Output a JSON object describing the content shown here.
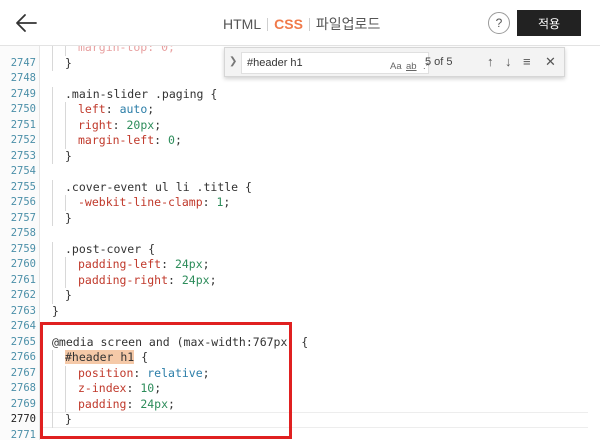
{
  "tabs": [
    {
      "label": "HTML",
      "active": false
    },
    {
      "label": "CSS",
      "active": true
    },
    {
      "label": "파일업로드",
      "active": false
    }
  ],
  "help_label": "?",
  "apply_label": "적용",
  "find": {
    "query": "#header h1",
    "match_case": "Aa",
    "whole_word": "ab",
    "regex": ".*",
    "count": "5 of 5"
  },
  "code_lines": [
    {
      "n": "2747",
      "html": "<span class=\"ind\"></span><span class=\"kw\">}</span>"
    },
    {
      "n": "2748",
      "html": ""
    },
    {
      "n": "2749",
      "html": "<span class=\"ind\"></span><span class=\"sel\">.main-slider .paging {</span>"
    },
    {
      "n": "2750",
      "html": "<span class=\"ind\"></span><span class=\"ind\"></span><span class=\"prop\">left</span>: <span class=\"val\">auto</span>;"
    },
    {
      "n": "2751",
      "html": "<span class=\"ind\"></span><span class=\"ind\"></span><span class=\"prop\">right</span>: <span class=\"num\">20px</span>;"
    },
    {
      "n": "2752",
      "html": "<span class=\"ind\"></span><span class=\"ind\"></span><span class=\"prop\">margin-left</span>: <span class=\"num\">0</span>;"
    },
    {
      "n": "2753",
      "html": "<span class=\"ind\"></span>}"
    },
    {
      "n": "2754",
      "html": ""
    },
    {
      "n": "2755",
      "html": "<span class=\"ind\"></span><span class=\"sel\">.cover-event ul li .title {</span>"
    },
    {
      "n": "2756",
      "html": "<span class=\"ind\"></span><span class=\"ind\"></span><span class=\"prop\">-webkit-line-clamp</span>: <span class=\"num\">1</span>;"
    },
    {
      "n": "2757",
      "html": "<span class=\"ind\"></span>}"
    },
    {
      "n": "2758",
      "html": ""
    },
    {
      "n": "2759",
      "html": "<span class=\"ind\"></span><span class=\"sel\">.post-cover {</span>"
    },
    {
      "n": "2760",
      "html": "<span class=\"ind\"></span><span class=\"ind\"></span><span class=\"prop\">padding-left</span>: <span class=\"num\">24px</span>;"
    },
    {
      "n": "2761",
      "html": "<span class=\"ind\"></span><span class=\"ind\"></span><span class=\"prop\">padding-right</span>: <span class=\"num\">24px</span>;"
    },
    {
      "n": "2762",
      "html": "<span class=\"ind\"></span>}"
    },
    {
      "n": "2763",
      "html": "}"
    },
    {
      "n": "2764",
      "html": ""
    },
    {
      "n": "2765",
      "html": "<span class=\"sel\">@media screen and (max-width:767px) {</span>"
    },
    {
      "n": "2766",
      "html": "<span class=\"ind\"></span><span class=\"sel hl\">#header h1</span> {"
    },
    {
      "n": "2767",
      "html": "<span class=\"ind\"></span><span class=\"ind\"></span><span class=\"prop\">position</span>: <span class=\"val\">relative</span>;"
    },
    {
      "n": "2768",
      "html": "<span class=\"ind\"></span><span class=\"ind\"></span><span class=\"prop\">z-index</span>: <span class=\"num\">10</span>;"
    },
    {
      "n": "2769",
      "html": "<span class=\"ind\"></span><span class=\"ind\"></span><span class=\"prop\">padding</span>: <span class=\"num\">24px</span>;"
    },
    {
      "n": "2770",
      "html": "<span class=\"ind\"></span>}",
      "current": true
    },
    {
      "n": "2771",
      "html": ""
    }
  ]
}
